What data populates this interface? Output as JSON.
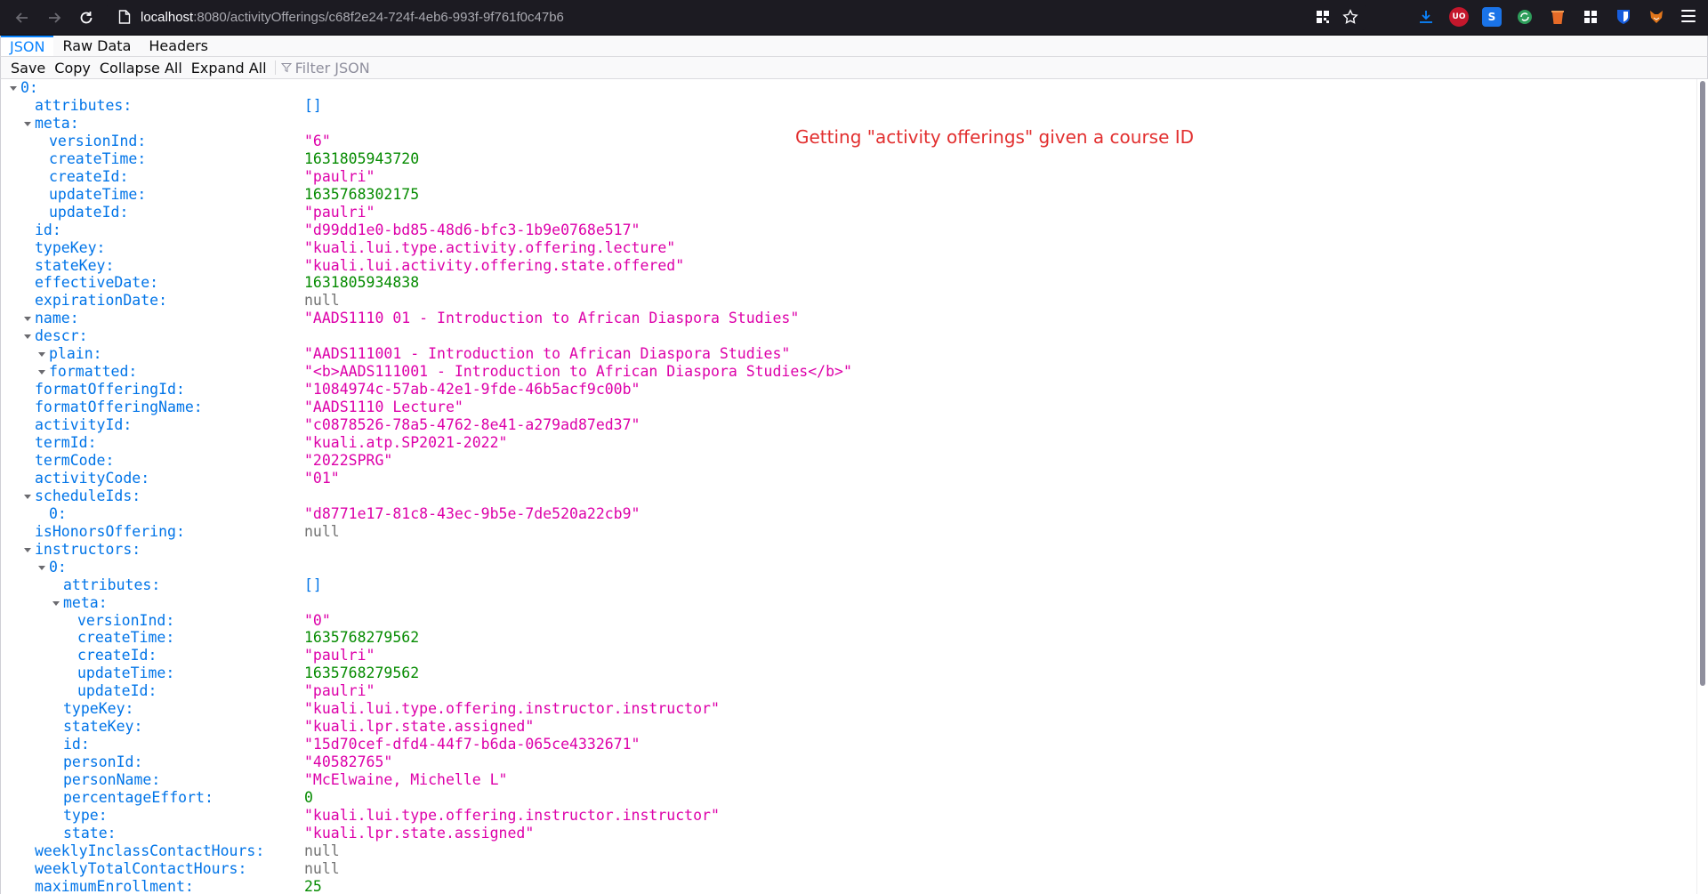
{
  "browser": {
    "url_host": "localhost",
    "url_path": ":8080/activityOfferings/c68f2e24-724f-4eb6-993f-9f761f0c47b6",
    "extensions": [
      {
        "name": "downloads-icon",
        "color": "#0a84ff"
      },
      {
        "name": "ublock-icon",
        "color": "#c4172c",
        "text": "UO"
      },
      {
        "name": "s-extension-icon",
        "color": "#1a73e8",
        "text": "S"
      },
      {
        "name": "refresh-extension-icon",
        "color": "#2e9e5b"
      },
      {
        "name": "bucket-extension-icon",
        "color": "#e66b28"
      },
      {
        "name": "grid-extension-icon",
        "color": "#fbfbfe"
      },
      {
        "name": "bitwarden-icon",
        "color": "#175ddc"
      },
      {
        "name": "fox-extension-icon",
        "color": "#e2761b"
      }
    ]
  },
  "viewer": {
    "tabs": [
      "JSON",
      "Raw Data",
      "Headers"
    ],
    "toolbar": {
      "save": "Save",
      "copy": "Copy",
      "collapse_all": "Collapse All",
      "expand_all": "Expand All",
      "filter_placeholder": "Filter JSON"
    }
  },
  "annotation": "Getting \"activity offerings\" given a course ID",
  "tree": [
    {
      "key": "0:",
      "depth": 0,
      "expandable": true,
      "value": "",
      "type": ""
    },
    {
      "key": "attributes:",
      "depth": 1,
      "expandable": false,
      "value": "[]",
      "type": "array"
    },
    {
      "key": "meta:",
      "depth": 1,
      "expandable": true,
      "value": "",
      "type": ""
    },
    {
      "key": "versionInd:",
      "depth": 2,
      "expandable": false,
      "value": "\"6\"",
      "type": "string"
    },
    {
      "key": "createTime:",
      "depth": 2,
      "expandable": false,
      "value": "1631805943720",
      "type": "number"
    },
    {
      "key": "createId:",
      "depth": 2,
      "expandable": false,
      "value": "\"paulri\"",
      "type": "string"
    },
    {
      "key": "updateTime:",
      "depth": 2,
      "expandable": false,
      "value": "1635768302175",
      "type": "number"
    },
    {
      "key": "updateId:",
      "depth": 2,
      "expandable": false,
      "value": "\"paulri\"",
      "type": "string"
    },
    {
      "key": "id:",
      "depth": 1,
      "expandable": false,
      "value": "\"d99dd1e0-bd85-48d6-bfc3-1b9e0768e517\"",
      "type": "string"
    },
    {
      "key": "typeKey:",
      "depth": 1,
      "expandable": false,
      "value": "\"kuali.lui.type.activity.offering.lecture\"",
      "type": "string"
    },
    {
      "key": "stateKey:",
      "depth": 1,
      "expandable": false,
      "value": "\"kuali.lui.activity.offering.state.offered\"",
      "type": "string"
    },
    {
      "key": "effectiveDate:",
      "depth": 1,
      "expandable": false,
      "value": "1631805934838",
      "type": "number"
    },
    {
      "key": "expirationDate:",
      "depth": 1,
      "expandable": false,
      "value": "null",
      "type": "null"
    },
    {
      "key": "name:",
      "depth": 1,
      "expandable": true,
      "value": "\"AADS1110 01 - Introduction to African Diaspora Studies\"",
      "type": "string"
    },
    {
      "key": "descr:",
      "depth": 1,
      "expandable": true,
      "value": "",
      "type": ""
    },
    {
      "key": "plain:",
      "depth": 2,
      "expandable": true,
      "value": "\"AADS111001 - Introduction to African Diaspora Studies\"",
      "type": "string"
    },
    {
      "key": "formatted:",
      "depth": 2,
      "expandable": true,
      "value": "\"<b>AADS111001 - Introduction to African Diaspora Studies</b>\"",
      "type": "string"
    },
    {
      "key": "formatOfferingId:",
      "depth": 1,
      "expandable": false,
      "value": "\"1084974c-57ab-42e1-9fde-46b5acf9c00b\"",
      "type": "string"
    },
    {
      "key": "formatOfferingName:",
      "depth": 1,
      "expandable": false,
      "value": "\"AADS1110 Lecture\"",
      "type": "string"
    },
    {
      "key": "activityId:",
      "depth": 1,
      "expandable": false,
      "value": "\"c0878526-78a5-4762-8e41-a279ad87ed37\"",
      "type": "string"
    },
    {
      "key": "termId:",
      "depth": 1,
      "expandable": false,
      "value": "\"kuali.atp.SP2021-2022\"",
      "type": "string"
    },
    {
      "key": "termCode:",
      "depth": 1,
      "expandable": false,
      "value": "\"2022SPRG\"",
      "type": "string"
    },
    {
      "key": "activityCode:",
      "depth": 1,
      "expandable": false,
      "value": "\"01\"",
      "type": "string"
    },
    {
      "key": "scheduleIds:",
      "depth": 1,
      "expandable": true,
      "value": "",
      "type": ""
    },
    {
      "key": "0:",
      "depth": 2,
      "expandable": false,
      "value": "\"d8771e17-81c8-43ec-9b5e-7de520a22cb9\"",
      "type": "string"
    },
    {
      "key": "isHonorsOffering:",
      "depth": 1,
      "expandable": false,
      "value": "null",
      "type": "null"
    },
    {
      "key": "instructors:",
      "depth": 1,
      "expandable": true,
      "value": "",
      "type": ""
    },
    {
      "key": "0:",
      "depth": 2,
      "expandable": true,
      "value": "",
      "type": ""
    },
    {
      "key": "attributes:",
      "depth": 3,
      "expandable": false,
      "value": "[]",
      "type": "array"
    },
    {
      "key": "meta:",
      "depth": 3,
      "expandable": true,
      "value": "",
      "type": ""
    },
    {
      "key": "versionInd:",
      "depth": 4,
      "expandable": false,
      "value": "\"0\"",
      "type": "string"
    },
    {
      "key": "createTime:",
      "depth": 4,
      "expandable": false,
      "value": "1635768279562",
      "type": "number"
    },
    {
      "key": "createId:",
      "depth": 4,
      "expandable": false,
      "value": "\"paulri\"",
      "type": "string"
    },
    {
      "key": "updateTime:",
      "depth": 4,
      "expandable": false,
      "value": "1635768279562",
      "type": "number"
    },
    {
      "key": "updateId:",
      "depth": 4,
      "expandable": false,
      "value": "\"paulri\"",
      "type": "string"
    },
    {
      "key": "typeKey:",
      "depth": 3,
      "expandable": false,
      "value": "\"kuali.lui.type.offering.instructor.instructor\"",
      "type": "string"
    },
    {
      "key": "stateKey:",
      "depth": 3,
      "expandable": false,
      "value": "\"kuali.lpr.state.assigned\"",
      "type": "string"
    },
    {
      "key": "id:",
      "depth": 3,
      "expandable": false,
      "value": "\"15d70cef-dfd4-44f7-b6da-065ce4332671\"",
      "type": "string"
    },
    {
      "key": "personId:",
      "depth": 3,
      "expandable": false,
      "value": "\"40582765\"",
      "type": "string"
    },
    {
      "key": "personName:",
      "depth": 3,
      "expandable": false,
      "value": "\"McElwaine, Michelle L\"",
      "type": "string"
    },
    {
      "key": "percentageEffort:",
      "depth": 3,
      "expandable": false,
      "value": "0",
      "type": "number"
    },
    {
      "key": "type:",
      "depth": 3,
      "expandable": false,
      "value": "\"kuali.lui.type.offering.instructor.instructor\"",
      "type": "string"
    },
    {
      "key": "state:",
      "depth": 3,
      "expandable": false,
      "value": "\"kuali.lpr.state.assigned\"",
      "type": "string"
    },
    {
      "key": "weeklyInclassContactHours:",
      "depth": 1,
      "expandable": false,
      "value": "null",
      "type": "null"
    },
    {
      "key": "weeklyTotalContactHours:",
      "depth": 1,
      "expandable": false,
      "value": "null",
      "type": "null"
    },
    {
      "key": "maximumEnrollment:",
      "depth": 1,
      "expandable": false,
      "value": "25",
      "type": "number"
    }
  ]
}
